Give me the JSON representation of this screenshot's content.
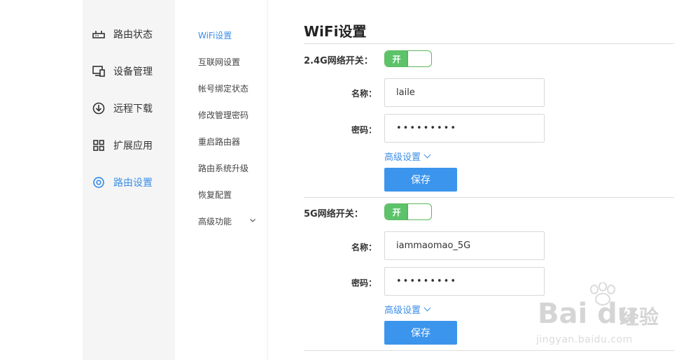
{
  "sidebar": {
    "items": [
      {
        "label": "路由状态",
        "icon": "router-icon"
      },
      {
        "label": "设备管理",
        "icon": "devices-icon"
      },
      {
        "label": "远程下载",
        "icon": "download-icon"
      },
      {
        "label": "扩展应用",
        "icon": "apps-grid-icon"
      },
      {
        "label": "路由设置",
        "icon": "gear-icon",
        "active": true
      }
    ]
  },
  "subnav": {
    "items": [
      {
        "label": "WiFi设置",
        "active": true
      },
      {
        "label": "互联网设置"
      },
      {
        "label": "帐号绑定状态"
      },
      {
        "label": "修改管理密码"
      },
      {
        "label": "重启路由器"
      },
      {
        "label": "路由系统升级"
      },
      {
        "label": "恢复配置"
      },
      {
        "label": "高级功能"
      }
    ]
  },
  "main": {
    "title": "WiFi设置",
    "band24": {
      "switch_label": "2.4G网络开关：",
      "switch_on_text": "开",
      "name_label": "名称：",
      "name_value": "laile",
      "password_label": "密码：",
      "password_value": "•••••••••",
      "advanced_label": "高级设置",
      "save_label": "保存"
    },
    "band5": {
      "switch_label": "5G网络开关：",
      "switch_on_text": "开",
      "name_label": "名称：",
      "name_value": "iammaomao_5G",
      "password_label": "密码：",
      "password_value": "•••••••••",
      "advanced_label": "高级设置",
      "save_label": "保存"
    }
  },
  "watermark": {
    "brand": "Bai du",
    "cn": "经验",
    "url": "jingyan.baidu.com"
  },
  "colors": {
    "accent": "#3b8ee8",
    "toggle_on": "#5cc36a",
    "button": "#3b95ec"
  }
}
